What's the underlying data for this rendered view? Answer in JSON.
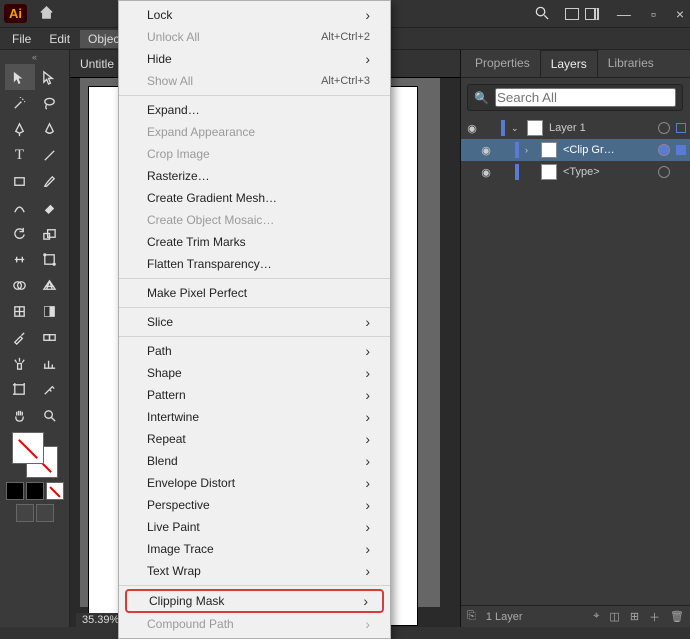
{
  "app": {
    "badge": "Ai"
  },
  "menubar": {
    "file": "File",
    "edit": "Edit",
    "object": "Object"
  },
  "document": {
    "tab": "Untitle",
    "zoom": "35.39%"
  },
  "context_menu": {
    "lock": "Lock",
    "unlock_all": "Unlock All",
    "unlock_all_shortcut": "Alt+Ctrl+2",
    "hide": "Hide",
    "show_all": "Show All",
    "show_all_shortcut": "Alt+Ctrl+3",
    "expand": "Expand…",
    "expand_appearance": "Expand Appearance",
    "crop_image": "Crop Image",
    "rasterize": "Rasterize…",
    "gradient_mesh": "Create Gradient Mesh…",
    "object_mosaic": "Create Object Mosaic…",
    "trim_marks": "Create Trim Marks",
    "flatten_transparency": "Flatten Transparency…",
    "pixel_perfect": "Make Pixel Perfect",
    "slice": "Slice",
    "path": "Path",
    "shape": "Shape",
    "pattern": "Pattern",
    "intertwine": "Intertwine",
    "repeat": "Repeat",
    "blend": "Blend",
    "envelope_distort": "Envelope Distort",
    "perspective": "Perspective",
    "live_paint": "Live Paint",
    "image_trace": "Image Trace",
    "text_wrap": "Text Wrap",
    "clipping_mask": "Clipping Mask",
    "compound_path": "Compound Path"
  },
  "panel": {
    "tabs": {
      "properties": "Properties",
      "layers": "Layers",
      "libraries": "Libraries"
    },
    "search_placeholder": "Search All",
    "layers": {
      "0": {
        "name": "Layer 1"
      },
      "1": {
        "name": "<Clip Gr…"
      },
      "2": {
        "name": "<Type>"
      }
    },
    "footer_count": "1 Layer"
  }
}
